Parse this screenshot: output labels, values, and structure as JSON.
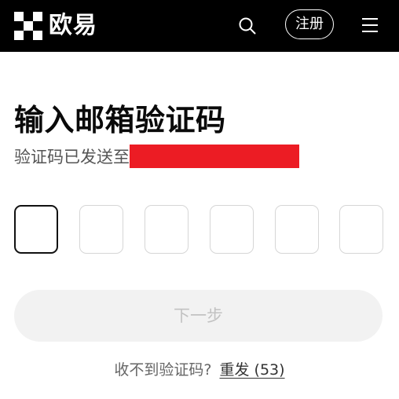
{
  "header": {
    "brand": "欧易",
    "signup_label": "注册",
    "icons": {
      "search": "search-icon",
      "menu": "hamburger-menu-icon",
      "logo": "okx-logo-icon"
    }
  },
  "main": {
    "title": "输入邮箱验证码",
    "subtitle": "验证码已发送至",
    "code_length": 6,
    "active_box_index": 0,
    "next_button_label": "下一步",
    "no_code_text": "收不到验证码?",
    "resend_label": "重发 (53)"
  },
  "colors": {
    "header_bg": "#000000",
    "redaction": "#ec1c24",
    "button_disabled_bg": "#f2f2f2",
    "button_disabled_text": "#c2c2c2"
  }
}
